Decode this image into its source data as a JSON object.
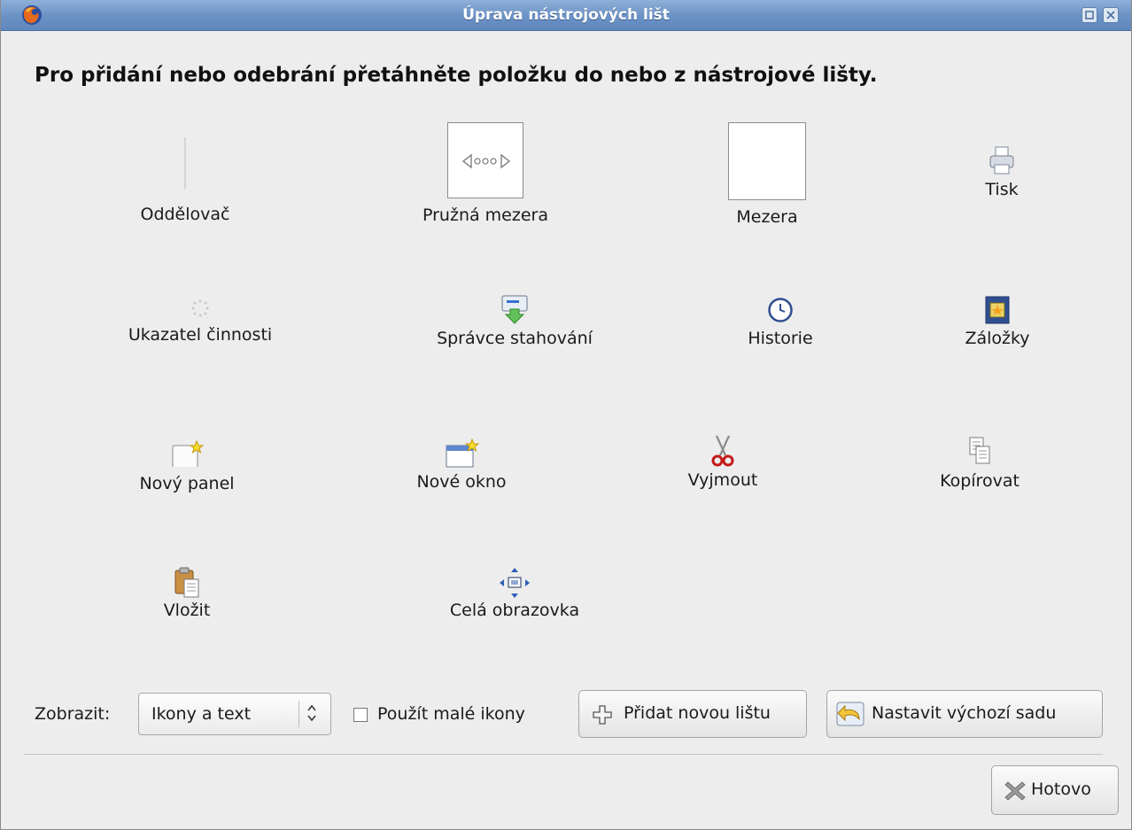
{
  "window": {
    "title": "Úprava nástrojových lišt"
  },
  "instructions": "Pro přidání nebo odebrání přetáhněte položku do nebo z nástrojové lišty.",
  "tools": [
    {
      "label": "Oddělovač",
      "icon": "separator-icon"
    },
    {
      "label": "Pružná mezera",
      "icon": "flexible-space-icon"
    },
    {
      "label": "Mezera",
      "icon": "space-icon"
    },
    {
      "label": "Tisk",
      "icon": "print-icon"
    },
    {
      "label": "Ukazatel činnosti",
      "icon": "activity-throbber-icon"
    },
    {
      "label": "Správce stahování",
      "icon": "download-manager-icon"
    },
    {
      "label": "Historie",
      "icon": "history-clock-icon"
    },
    {
      "label": "Záložky",
      "icon": "bookmarks-icon"
    },
    {
      "label": "Nový panel",
      "icon": "new-tab-icon"
    },
    {
      "label": "Nové okno",
      "icon": "new-window-icon"
    },
    {
      "label": "Vyjmout",
      "icon": "cut-scissors-icon"
    },
    {
      "label": "Kopírovat",
      "icon": "copy-icon"
    },
    {
      "label": "Vložit",
      "icon": "paste-clipboard-icon"
    },
    {
      "label": "Celá obrazovka",
      "icon": "fullscreen-icon"
    }
  ],
  "controls": {
    "show_label": "Zobrazit:",
    "show_value": "Ikony a text",
    "small_icons_label": "Použít malé ikony",
    "small_icons_checked": false,
    "add_toolbar_label": "Přidat novou lištu",
    "restore_default_label": "Nastavit výchozí sadu",
    "done_label": "Hotovo"
  }
}
